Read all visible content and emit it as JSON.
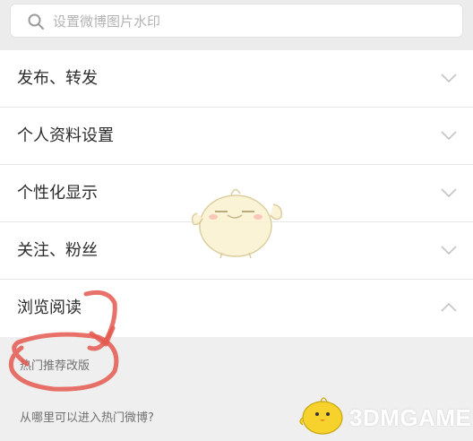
{
  "search": {
    "placeholder": "设置微博图片水印",
    "icon": "search-icon"
  },
  "faq": {
    "items": [
      {
        "label": "发布、转发",
        "state": "collapsed"
      },
      {
        "label": "个人资料设置",
        "state": "collapsed"
      },
      {
        "label": "个性化显示",
        "state": "collapsed"
      },
      {
        "label": "关注、粉丝",
        "state": "collapsed"
      },
      {
        "label": "浏览阅读",
        "state": "expanded"
      }
    ],
    "expanded_children": [
      {
        "label": "热门推荐改版"
      },
      {
        "label": "从哪里可以进入热门微博?"
      }
    ]
  },
  "watermark": {
    "text": "3DMGAME"
  },
  "colors": {
    "annotation": "#e4594f",
    "text": "#2b2b2b",
    "subtext": "#6f6f6f",
    "chevron": "#c4c4c4",
    "panel": "#efefef"
  }
}
